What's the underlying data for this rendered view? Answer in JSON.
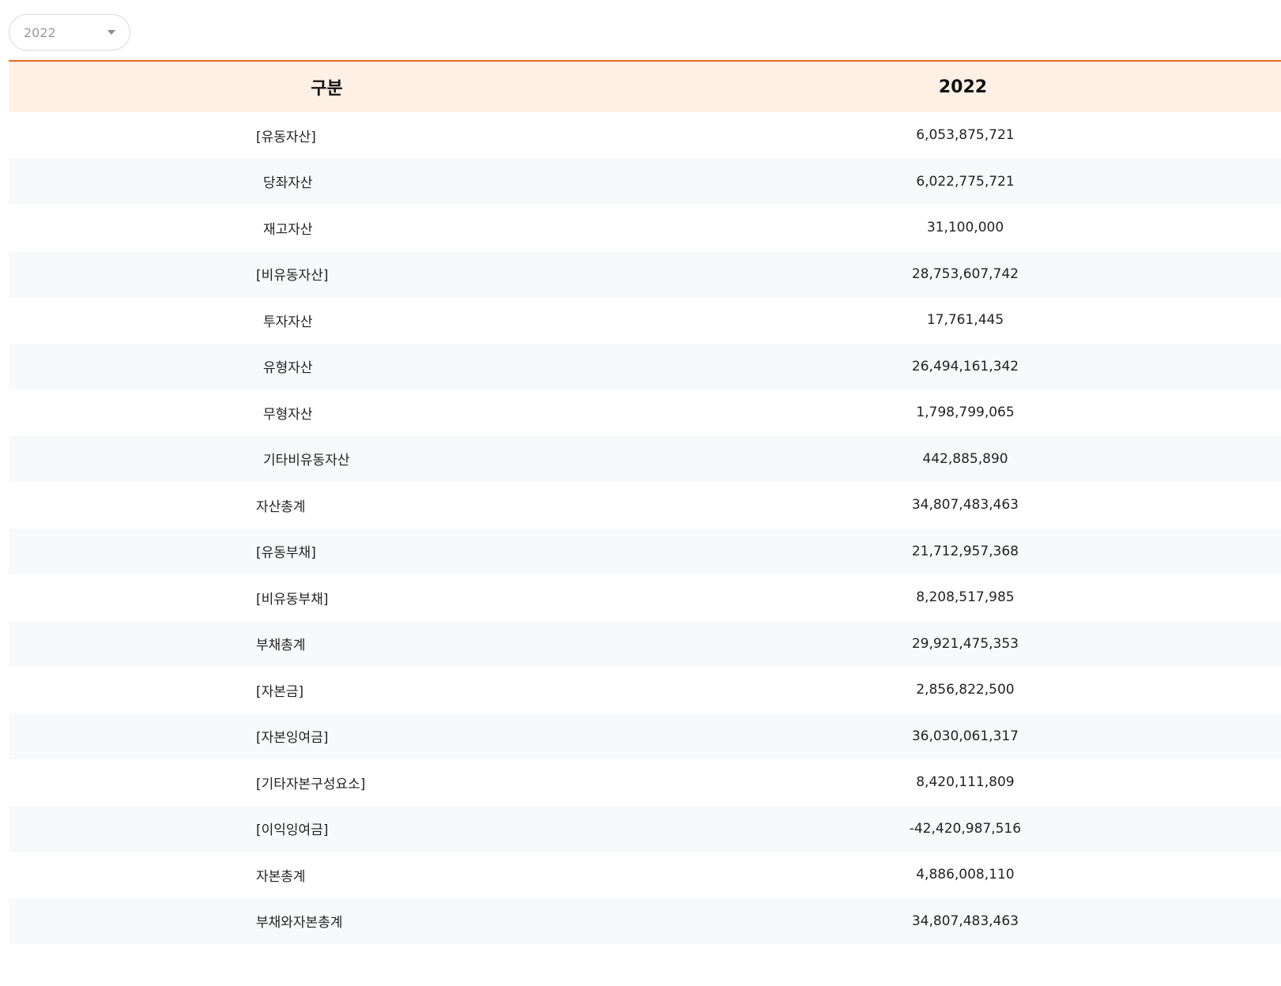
{
  "filter": {
    "selected_year": "2022"
  },
  "table": {
    "headers": {
      "label": "구분",
      "value": "2022"
    },
    "rows": [
      {
        "label": "[유동자산]",
        "value": "6,053,875,721",
        "level": 1
      },
      {
        "label": "당좌자산",
        "value": "6,022,775,721",
        "level": 2
      },
      {
        "label": "재고자산",
        "value": "31,100,000",
        "level": 2
      },
      {
        "label": "[비유동자산]",
        "value": "28,753,607,742",
        "level": 1
      },
      {
        "label": "투자자산",
        "value": "17,761,445",
        "level": 2
      },
      {
        "label": "유형자산",
        "value": "26,494,161,342",
        "level": 2
      },
      {
        "label": "무형자산",
        "value": "1,798,799,065",
        "level": 2
      },
      {
        "label": "기타비유동자산",
        "value": "442,885,890",
        "level": 2
      },
      {
        "label": "자산총계",
        "value": "34,807,483,463",
        "level": 0
      },
      {
        "label": "[유동부채]",
        "value": "21,712,957,368",
        "level": 1
      },
      {
        "label": "[비유동부채]",
        "value": "8,208,517,985",
        "level": 1
      },
      {
        "label": "부채총계",
        "value": "29,921,475,353",
        "level": 0
      },
      {
        "label": "[자본금]",
        "value": "2,856,822,500",
        "level": 1
      },
      {
        "label": "[자본잉여금]",
        "value": "36,030,061,317",
        "level": 1
      },
      {
        "label": "[기타자본구성요소]",
        "value": "8,420,111,809",
        "level": 1
      },
      {
        "label": "[이익잉여금]",
        "value": "-42,420,987,516",
        "level": 1
      },
      {
        "label": "자본총계",
        "value": "4,886,008,110",
        "level": 0
      },
      {
        "label": "부채와자본총계",
        "value": "34,807,483,463",
        "level": 0
      }
    ]
  }
}
